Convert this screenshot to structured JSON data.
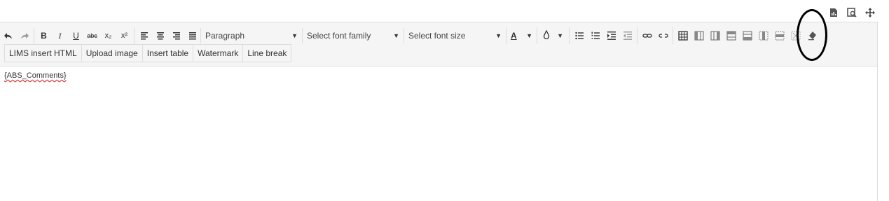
{
  "toolbar": {
    "block_format": "Paragraph",
    "font_family_placeholder": "Select font family",
    "font_size_placeholder": "Select font size",
    "color_label": "A",
    "subscript": "x₂",
    "superscript": "x²",
    "strike": "abc",
    "bold": "B",
    "italic": "I",
    "underline": "U"
  },
  "toolbar2": {
    "lims_insert_html": "LIMS insert HTML",
    "upload_image": "Upload image",
    "insert_table": "Insert table",
    "watermark": "Watermark",
    "line_break": "Line break"
  },
  "content": {
    "text": "{ABS_Comments}"
  }
}
